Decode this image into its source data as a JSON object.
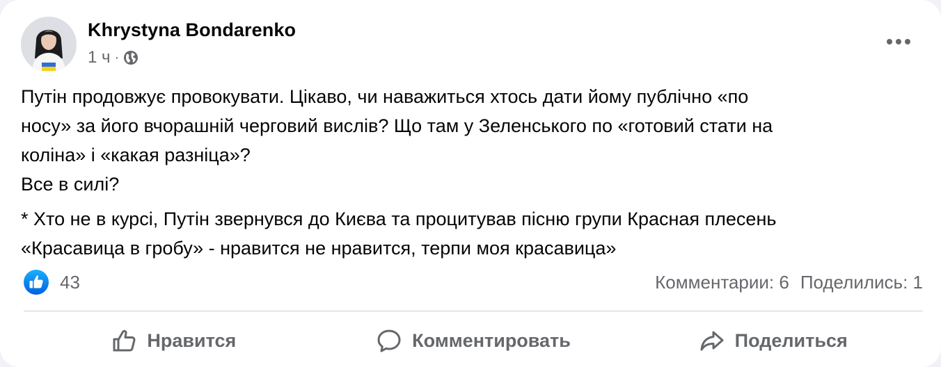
{
  "post": {
    "author": "Khrystyna Bondarenko",
    "time": "1 ч",
    "separator": "·",
    "audience_icon": "globe-icon",
    "body": {
      "paragraph1": [
        "Путін продовжує провокувати. Цікаво, чи наважиться хтось дати йому публічно «по",
        "носу» за його вчорашній черговий вислів?  Що там у Зеленського по «готовий стати на",
        "коліна» і «какая разніца»?",
        "Все в силі?"
      ],
      "paragraph2": [
        "* Хто не в курсі, Путін звернувся до Києва та процитував пісню групи Красная плесень",
        "«Красавица в гробу» - нравится не нравится, терпи моя красавица»"
      ]
    }
  },
  "reactions": {
    "icon": "like-icon",
    "count": "43"
  },
  "stats": {
    "comments": "Комментарии: 6",
    "shares": "Поделились: 1"
  },
  "actions": {
    "like": "Нравится",
    "comment": "Комментировать",
    "share": "Поделиться"
  },
  "colors": {
    "accent": "#1877f2",
    "secondary_text": "#65676b",
    "divider": "#ced0d4"
  }
}
